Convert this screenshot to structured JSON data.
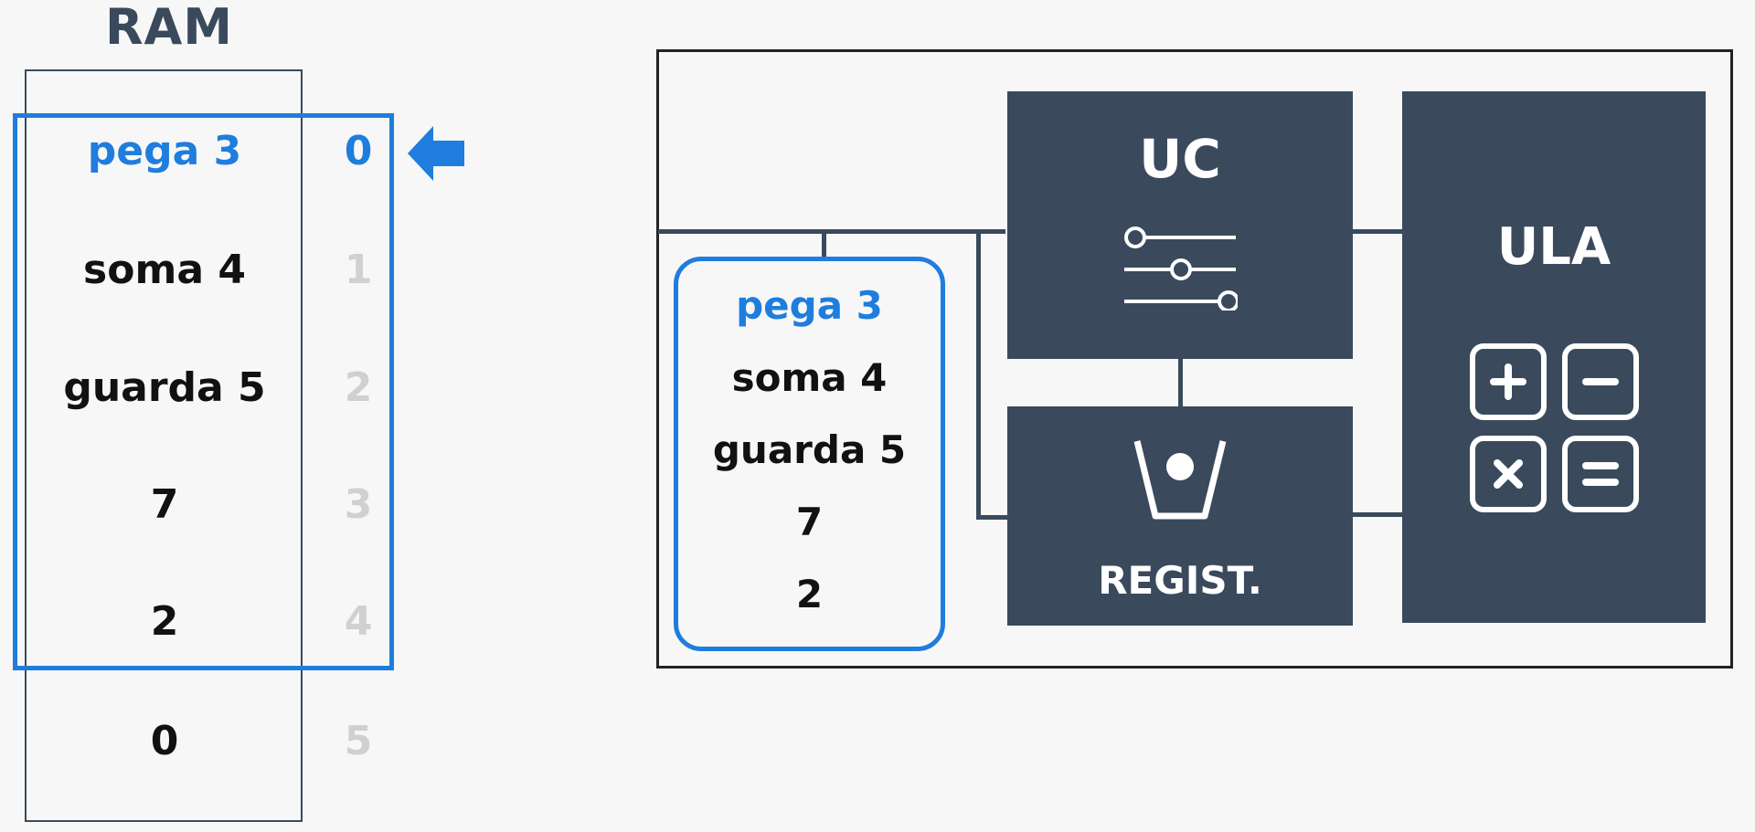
{
  "ram": {
    "title": "RAM",
    "cells": [
      {
        "value": "pega 3",
        "address": "0"
      },
      {
        "value": "soma 4",
        "address": "1"
      },
      {
        "value": "guarda 5",
        "address": "2"
      },
      {
        "value": "7",
        "address": "3"
      },
      {
        "value": "2",
        "address": "4"
      },
      {
        "value": "0",
        "address": "5"
      }
    ],
    "active_index": 0
  },
  "cpu": {
    "cache": [
      "pega 3",
      "soma 4",
      "guarda 5",
      "7",
      "2"
    ],
    "uc": {
      "label": "UC",
      "icon": "sliders-icon"
    },
    "registers": {
      "label": "REGIST.",
      "icon": "register-cup-icon"
    },
    "ula": {
      "label": "ULA",
      "icon": "calculator-icon"
    }
  },
  "colors": {
    "accent": "#1f7ddd",
    "block": "#3a4a5c",
    "inactive_address": "#d0d0d0",
    "text": "#111111"
  }
}
